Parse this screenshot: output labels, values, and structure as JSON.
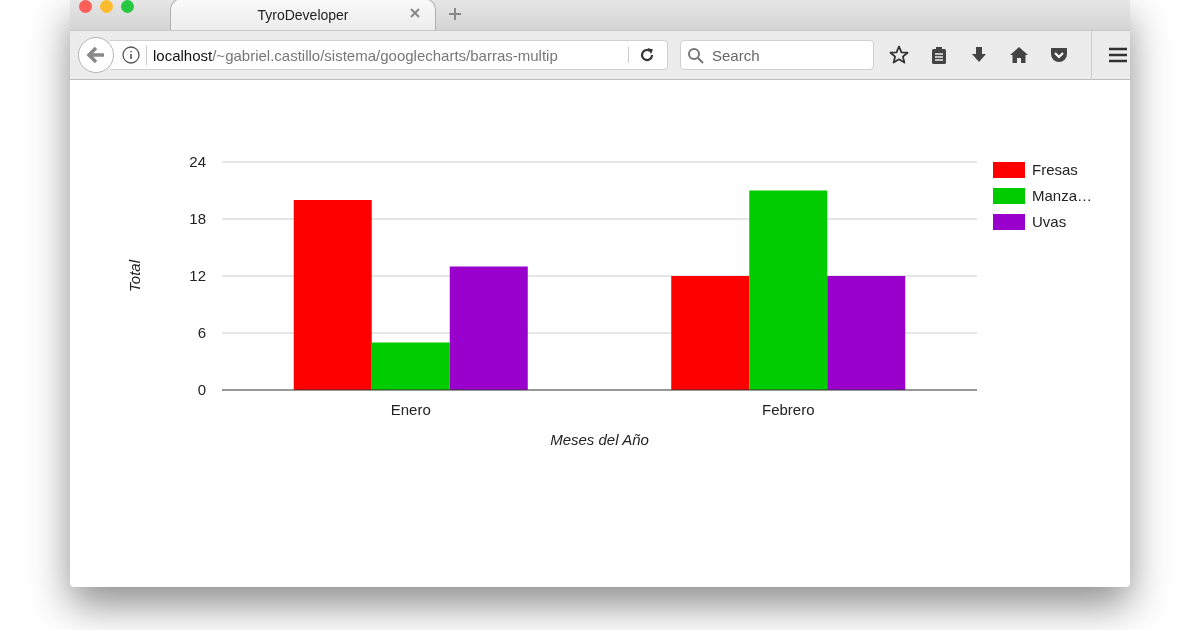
{
  "tab": {
    "title": "TyroDeveloper"
  },
  "toolbar": {
    "url_host": "localhost",
    "url_path": "/~gabriel.castillo/sistema/googlecharts/barras-multip",
    "search": {
      "placeholder": "Search"
    }
  },
  "chart": {
    "chart_data": {
      "type": "bar",
      "xlabel": "Meses del Año",
      "ylabel": "Total",
      "categories": [
        "Enero",
        "Febrero"
      ],
      "series": [
        {
          "name": "Fresas",
          "color": "#ff0000",
          "values": [
            20,
            12
          ]
        },
        {
          "name": "Manza…",
          "color": "#00cc00",
          "values": [
            5,
            21
          ]
        },
        {
          "name": "Uvas",
          "color": "#9900cc",
          "values": [
            13,
            12
          ]
        }
      ],
      "ylim": [
        0,
        24
      ],
      "yticks": [
        0,
        6,
        12,
        18,
        24
      ],
      "grid": true,
      "legend": "right"
    }
  }
}
